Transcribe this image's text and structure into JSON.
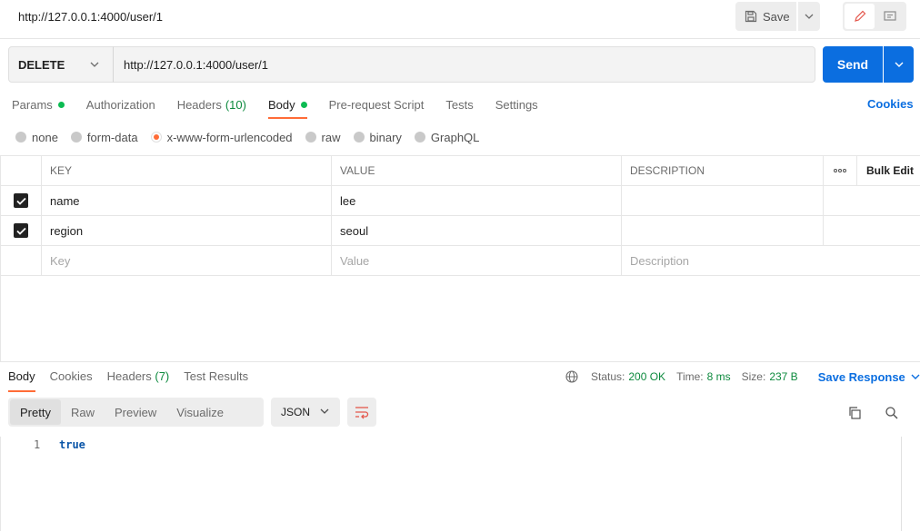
{
  "request": {
    "title": "http://127.0.0.1:4000/user/1",
    "save_label": "Save",
    "method": "DELETE",
    "url": "http://127.0.0.1:4000/user/1",
    "send_label": "Send"
  },
  "request_tabs": [
    {
      "label": "Params",
      "indicator": "dot"
    },
    {
      "label": "Authorization"
    },
    {
      "label": "Headers",
      "count": "(10)"
    },
    {
      "label": "Body",
      "indicator": "dot",
      "active": true
    },
    {
      "label": "Pre-request Script"
    },
    {
      "label": "Tests"
    },
    {
      "label": "Settings"
    }
  ],
  "cookies_label": "Cookies",
  "body_types": [
    {
      "label": "none"
    },
    {
      "label": "form-data"
    },
    {
      "label": "x-www-form-urlencoded",
      "selected": true
    },
    {
      "label": "raw"
    },
    {
      "label": "binary"
    },
    {
      "label": "GraphQL"
    }
  ],
  "table": {
    "headers": {
      "key": "KEY",
      "value": "VALUE",
      "description": "DESCRIPTION",
      "bulk_edit": "Bulk Edit"
    },
    "rows": [
      {
        "checked": true,
        "key": "name",
        "value": "lee",
        "description": ""
      },
      {
        "checked": true,
        "key": "region",
        "value": "seoul",
        "description": ""
      }
    ],
    "placeholders": {
      "key": "Key",
      "value": "Value",
      "description": "Description"
    }
  },
  "response": {
    "tabs": [
      {
        "label": "Body",
        "active": true
      },
      {
        "label": "Cookies"
      },
      {
        "label": "Headers",
        "count": "(7)"
      },
      {
        "label": "Test Results"
      }
    ],
    "status_label": "Status:",
    "status_value": "200 OK",
    "time_label": "Time:",
    "time_value": "8 ms",
    "size_label": "Size:",
    "size_value": "237 B",
    "save_response_label": "Save Response",
    "view_tabs": [
      "Pretty",
      "Raw",
      "Preview",
      "Visualize"
    ],
    "active_view": "Pretty",
    "format": "JSON",
    "lines": [
      {
        "num": "1",
        "text": "true"
      }
    ]
  },
  "colors": {
    "accent": "#ff6c37",
    "primary": "#0b6ee0",
    "success": "#0cbb52"
  }
}
